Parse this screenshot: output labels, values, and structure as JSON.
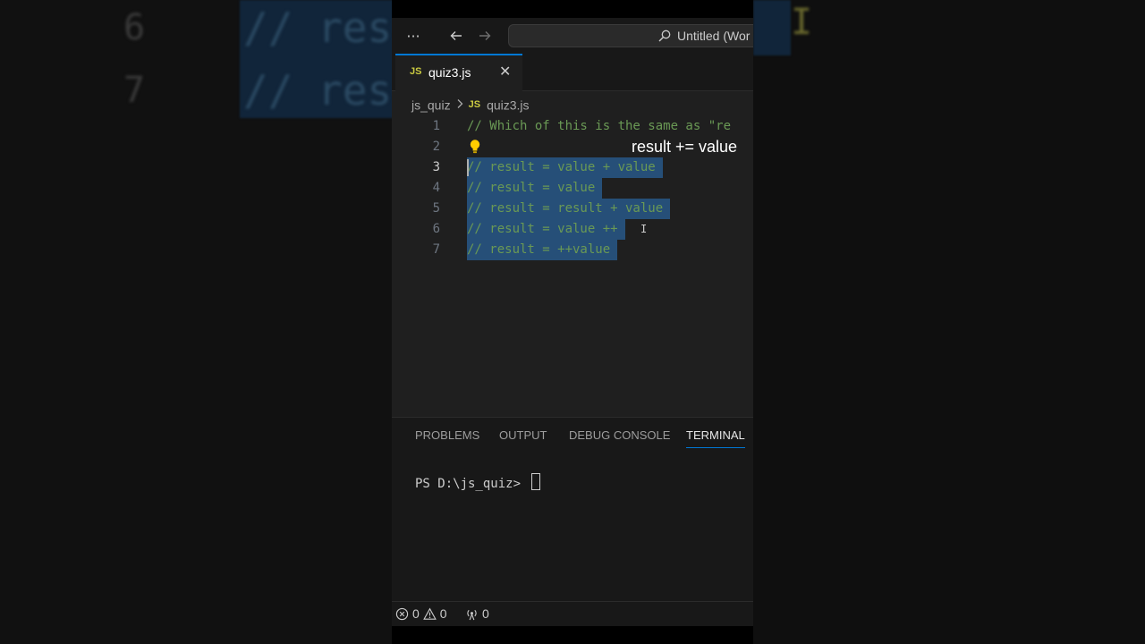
{
  "background": {
    "line_numbers": [
      "6",
      "7"
    ],
    "code": [
      "// res",
      "// res"
    ]
  },
  "titlebar": {
    "more_icon": "ellipsis-icon",
    "back_icon": "arrow-left-icon",
    "forward_icon": "arrow-right-icon",
    "search_text": "Untitled (Wor"
  },
  "tabs": [
    {
      "badge": "JS",
      "label": "quiz3.js",
      "close": "✕"
    }
  ],
  "breadcrumb": {
    "folder": "js_quiz",
    "file_badge": "JS",
    "file": "quiz3.js"
  },
  "editor": {
    "lines": [
      {
        "num": "1",
        "text": "// Which of this is the same as \"re"
      },
      {
        "num": "2",
        "text": ""
      },
      {
        "num": "3",
        "text": "// result = value + value"
      },
      {
        "num": "4",
        "text": "// result = value"
      },
      {
        "num": "5",
        "text": "// result = result + value"
      },
      {
        "num": "6",
        "text": "// result = value ++"
      },
      {
        "num": "7",
        "text": "// result = ++value"
      }
    ],
    "overlay": "result += value",
    "colors": {
      "comment": "#6a9955",
      "selection": "#264f78",
      "accent": "#0078d4"
    }
  },
  "panel": {
    "tabs": [
      "PROBLEMS",
      "OUTPUT",
      "DEBUG CONSOLE",
      "TERMINAL"
    ],
    "terminal_prompt": "PS D:\\js_quiz> "
  },
  "statusbar": {
    "errors": "0",
    "warnings": "0",
    "ports": "0"
  }
}
